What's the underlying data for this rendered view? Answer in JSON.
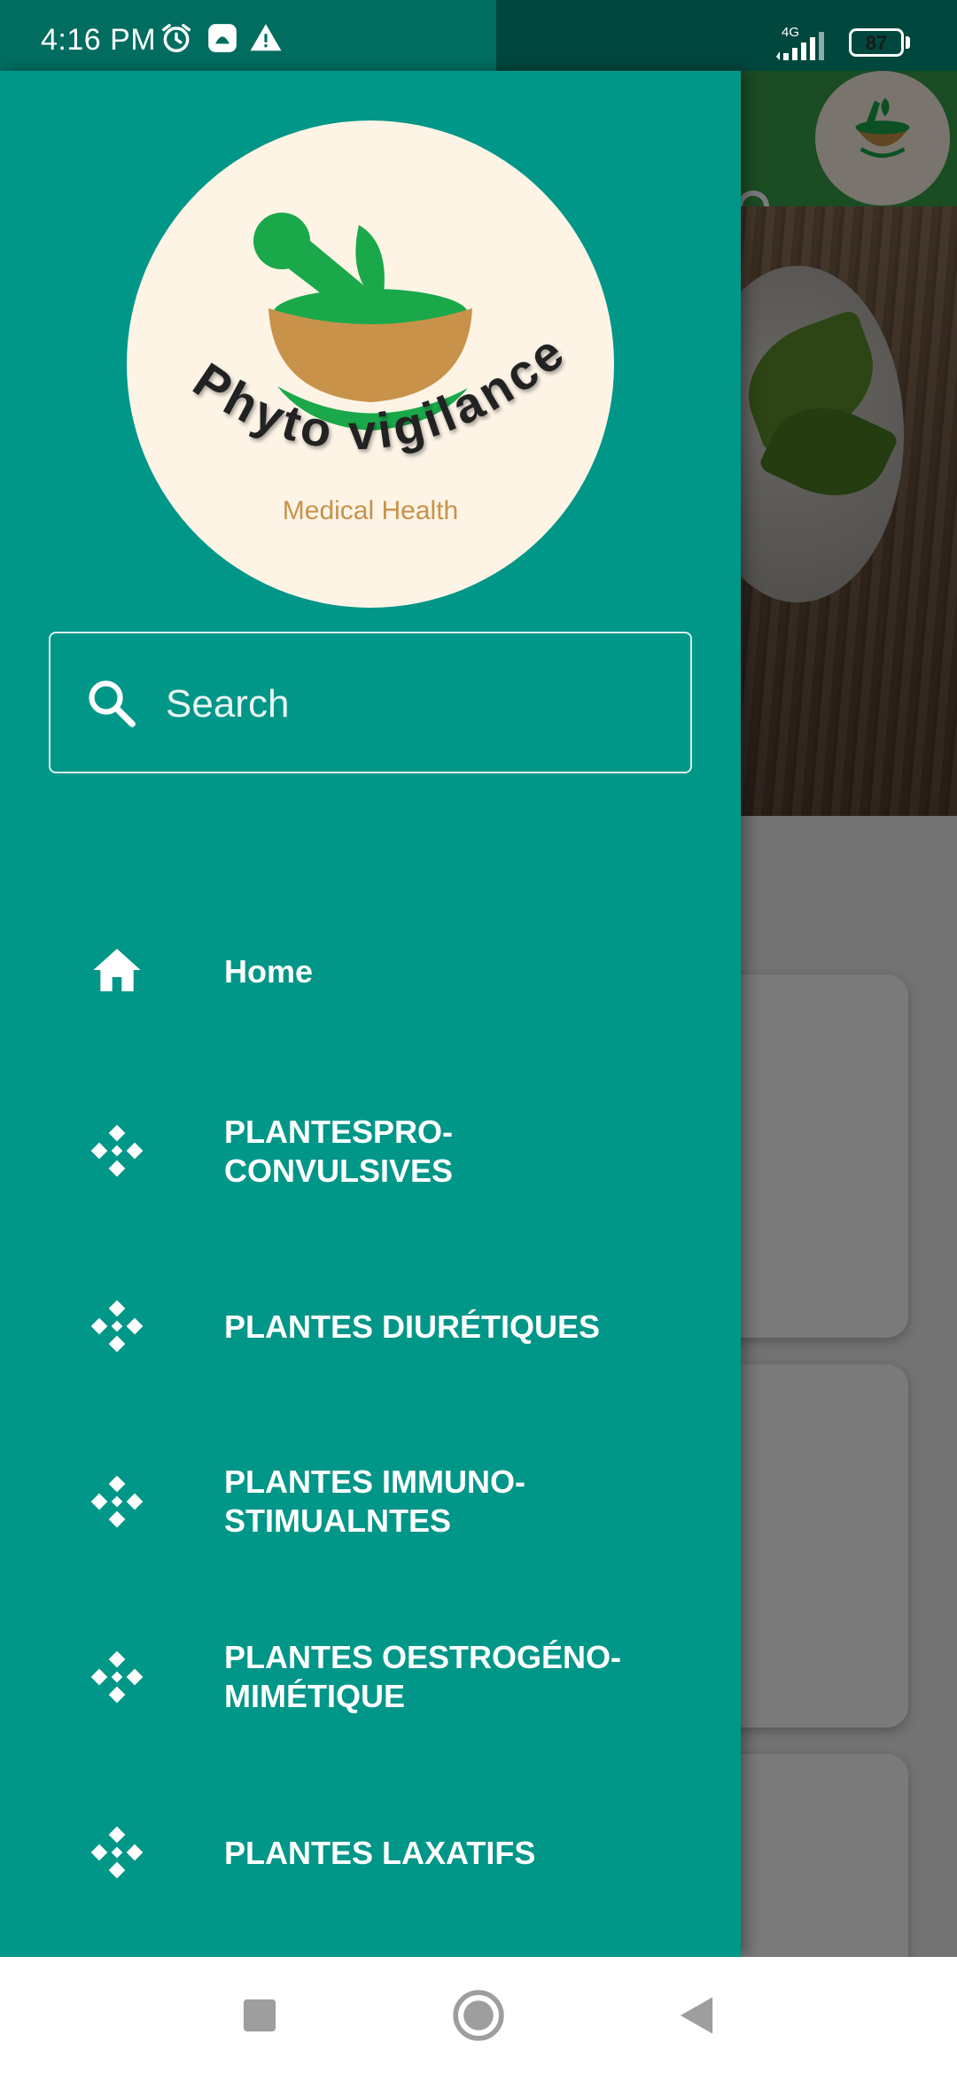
{
  "status_bar": {
    "time": "4:16 PM",
    "network": "4G",
    "battery": "87",
    "battery_level": 0.87,
    "icons": [
      "alarm-icon",
      "app-notification-icon",
      "warning-icon",
      "signal-icon",
      "battery-icon"
    ]
  },
  "brand": {
    "name": "Phyto vigilance",
    "tagline": "Medical Health"
  },
  "drawer": {
    "search_placeholder": "Search",
    "items": [
      {
        "label": "Home",
        "icon": "home-icon"
      },
      {
        "label": "PLANTESPRO-\nCONVULSIVES",
        "icon": "grid-diamond-icon"
      },
      {
        "label": "PLANTES DIURÉTIQUES",
        "icon": "grid-diamond-icon"
      },
      {
        "label": "PLANTES IMMUNO-\nSTIMUALNTES",
        "icon": "grid-diamond-icon"
      },
      {
        "label": "PLANTES OESTROGÉNO-\nMIMÉTIQUE",
        "icon": "grid-diamond-icon"
      },
      {
        "label": "PLANTES LAXATIFS",
        "icon": "grid-diamond-icon"
      }
    ]
  },
  "colors": {
    "drawer": "#009688",
    "status_bar": "#016d60",
    "toolbar": "#3aa04a",
    "logo_bg": "#fdf4e6",
    "logo_green": "#1aa84a",
    "logo_bowl": "#c8924a"
  },
  "nav_bar": {
    "icons": [
      "recents-square-icon",
      "home-circle-icon",
      "back-triangle-icon"
    ]
  }
}
